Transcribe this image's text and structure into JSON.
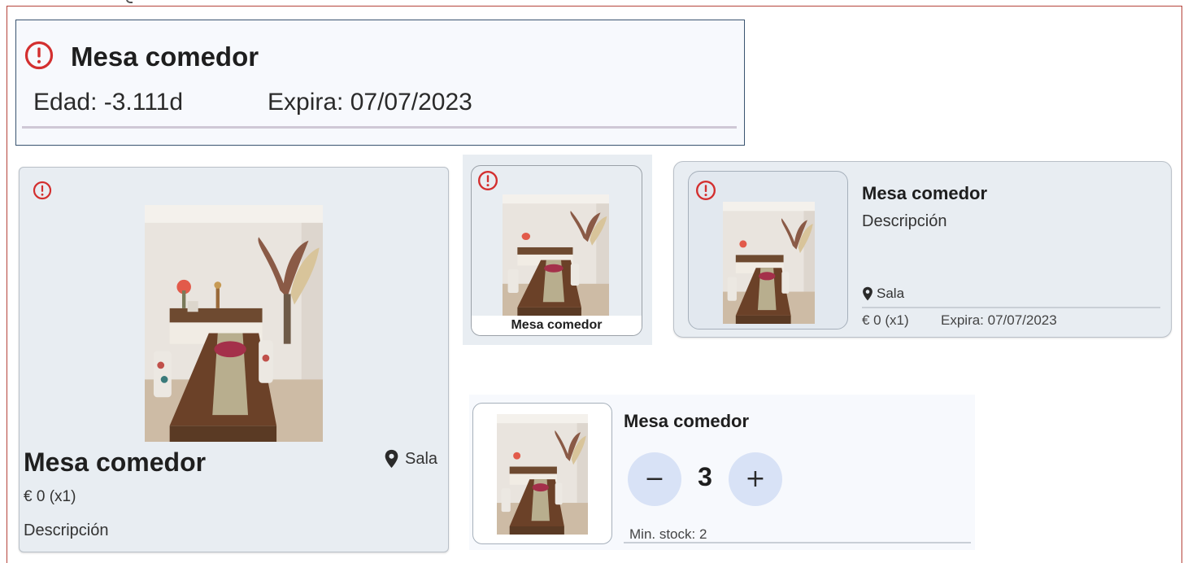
{
  "header": {
    "alert_icon": "error-outline-icon",
    "title": "Mesa comedor",
    "age": "Edad: -3.111d",
    "expiry": "Expira: 07/07/2023"
  },
  "large_card": {
    "alert_icon": "error-outline-icon",
    "title": "Mesa comedor",
    "location_icon": "location-pin-icon",
    "location": "Sala",
    "price": "€ 0  (x1)",
    "description": "Descripción"
  },
  "tile_card": {
    "alert_icon": "error-outline-icon",
    "caption": "Mesa comedor"
  },
  "list_card": {
    "alert_icon": "error-outline-icon",
    "title": "Mesa comedor",
    "description": "Descripción",
    "location_icon": "location-pin-icon",
    "location": "Sala",
    "price": "€ 0  (x1)",
    "expiry": "Expira: 07/07/2023"
  },
  "stock_card": {
    "title": "Mesa comedor",
    "decrement_label": "−",
    "quantity": "3",
    "increment_label": "+",
    "min_stock": "Min. stock: 2"
  },
  "colors": {
    "alert_red": "#d32f2f",
    "card_background": "#e8edf2",
    "stepper_button": "#d8e2f6",
    "frame_border": "#b5443b"
  }
}
